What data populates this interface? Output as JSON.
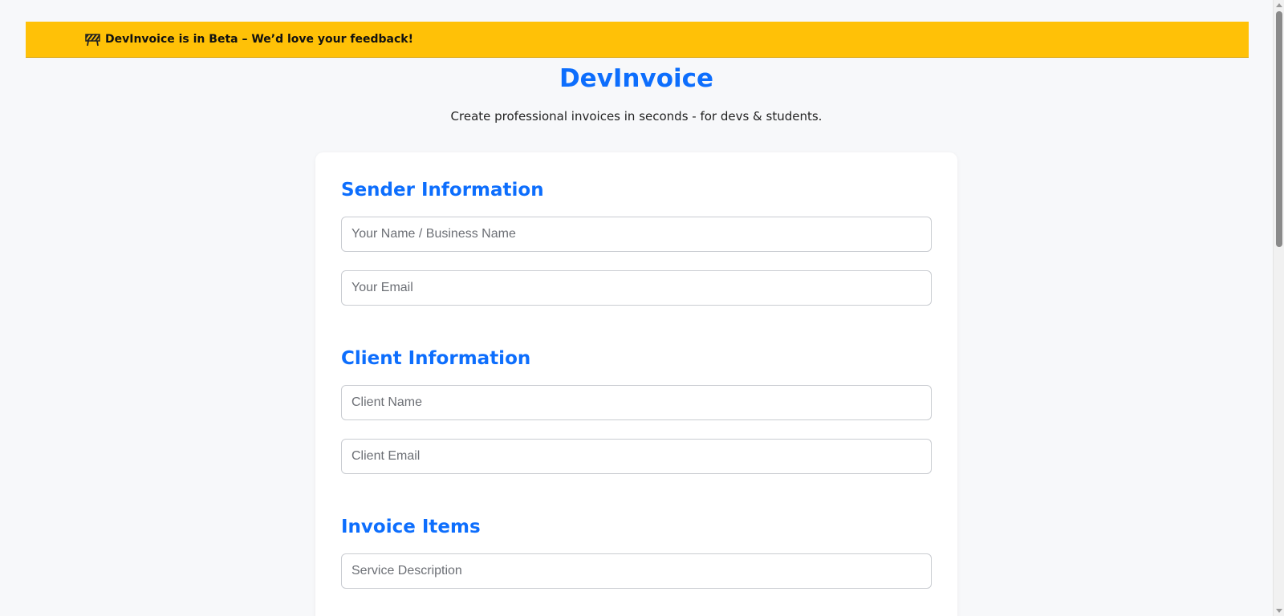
{
  "banner": {
    "icon": "construction-barrier-icon",
    "text": "DevInvoice is in Beta – We’d love your feedback!",
    "background": "#ffc107"
  },
  "header": {
    "title": "DevInvoice",
    "subtitle": "Create professional invoices in seconds - for devs & students.",
    "accent": "#0d6efd"
  },
  "sender": {
    "heading": "Sender Information",
    "name_placeholder": "Your Name / Business Name",
    "name_value": "",
    "email_placeholder": "Your Email",
    "email_value": ""
  },
  "client": {
    "heading": "Client Information",
    "name_placeholder": "Client Name",
    "name_value": "",
    "email_placeholder": "Client Email",
    "email_value": ""
  },
  "items": {
    "heading": "Invoice Items",
    "description_placeholder": "Service Description",
    "description_value": ""
  }
}
